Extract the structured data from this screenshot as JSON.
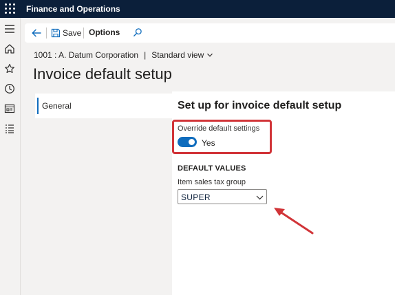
{
  "app": {
    "title": "Finance and Operations"
  },
  "nav": {
    "icons": [
      "hamburger-icon",
      "home-icon",
      "star-icon",
      "clock-icon",
      "workspace-icon",
      "list-icon"
    ]
  },
  "toolbar": {
    "save_label": "Save",
    "options_label": "Options"
  },
  "context": {
    "company": "1001 : A. Datum Corporation",
    "separator": "|",
    "view": "Standard view"
  },
  "page": {
    "title": "Invoice default setup"
  },
  "tabs": [
    {
      "label": "General"
    }
  ],
  "section": {
    "title": "Set up for invoice default setup",
    "override": {
      "label": "Override default settings",
      "value_text": "Yes",
      "checked": true
    },
    "defaults": {
      "heading": "DEFAULT VALUES",
      "item_sales_tax_group": {
        "label": "Item sales tax group",
        "value": "SUPER"
      }
    }
  },
  "colors": {
    "topbar": "#0b1f3a",
    "accent": "#0f6cbd",
    "annotation": "#d13438"
  }
}
